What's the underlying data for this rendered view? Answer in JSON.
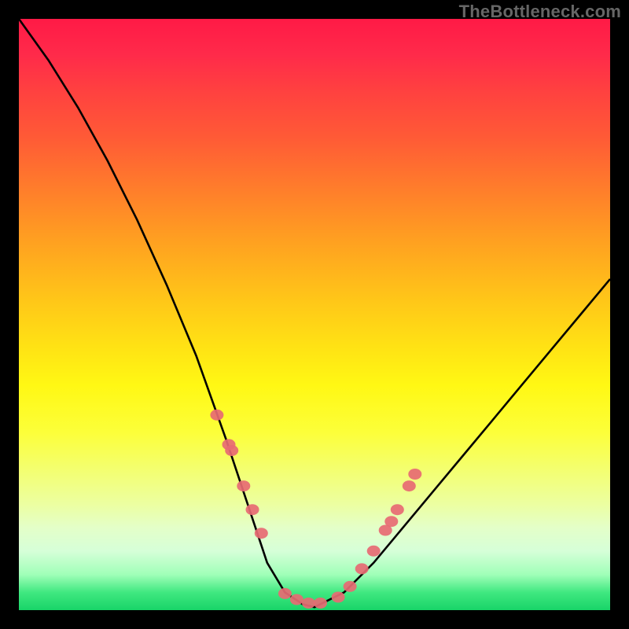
{
  "watermark": "TheBottleneck.com",
  "chart_data": {
    "type": "line",
    "title": "",
    "xlabel": "",
    "ylabel": "",
    "xlim": [
      0,
      100
    ],
    "ylim": [
      0,
      100
    ],
    "series": [
      {
        "name": "bottleneck-curve",
        "x": [
          0,
          5,
          10,
          15,
          20,
          25,
          30,
          35,
          40,
          42,
          45,
          48,
          50,
          55,
          60,
          65,
          70,
          75,
          80,
          85,
          90,
          95,
          100
        ],
        "y": [
          100,
          93,
          85,
          76,
          66,
          55,
          43,
          29,
          14,
          8,
          3,
          1,
          0.5,
          3,
          8,
          14,
          20,
          26,
          32,
          38,
          44,
          50,
          56
        ]
      }
    ],
    "markers": {
      "name": "data-points",
      "x": [
        33.5,
        35.5,
        36,
        38,
        39.5,
        41,
        45,
        47,
        49,
        51,
        54,
        56,
        58,
        60,
        62,
        63,
        64,
        66,
        67
      ],
      "y": [
        33,
        28,
        27,
        21,
        17,
        13,
        2.8,
        1.8,
        1.2,
        1.2,
        2.2,
        4,
        7,
        10,
        13.5,
        15,
        17,
        21,
        23
      ]
    },
    "marker_color": "#e76a73",
    "curve_color": "#000000"
  }
}
